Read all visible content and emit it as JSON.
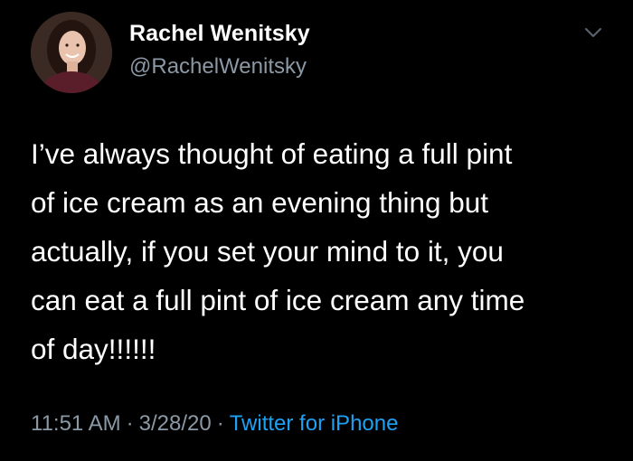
{
  "tweet": {
    "author": {
      "display_name": "Rachel Wenitsky",
      "handle": "@RachelWenitsky",
      "avatar_icon": "profile-photo"
    },
    "text_lines": [
      "I’ve always thought of eating a full pint",
      "of ice cream as an evening thing but",
      "actually, if you set your mind to it, you",
      "can eat a full pint of ice cream any time",
      "of day!!!!!!"
    ],
    "meta": {
      "time": "11:51 AM",
      "separator": "·",
      "date": "3/28/20",
      "source": "Twitter for iPhone"
    },
    "menu_icon": "chevron-down-icon"
  },
  "colors": {
    "background": "#000000",
    "text": "#ffffff",
    "secondary": "#8b98a5",
    "link": "#1da1f2"
  }
}
